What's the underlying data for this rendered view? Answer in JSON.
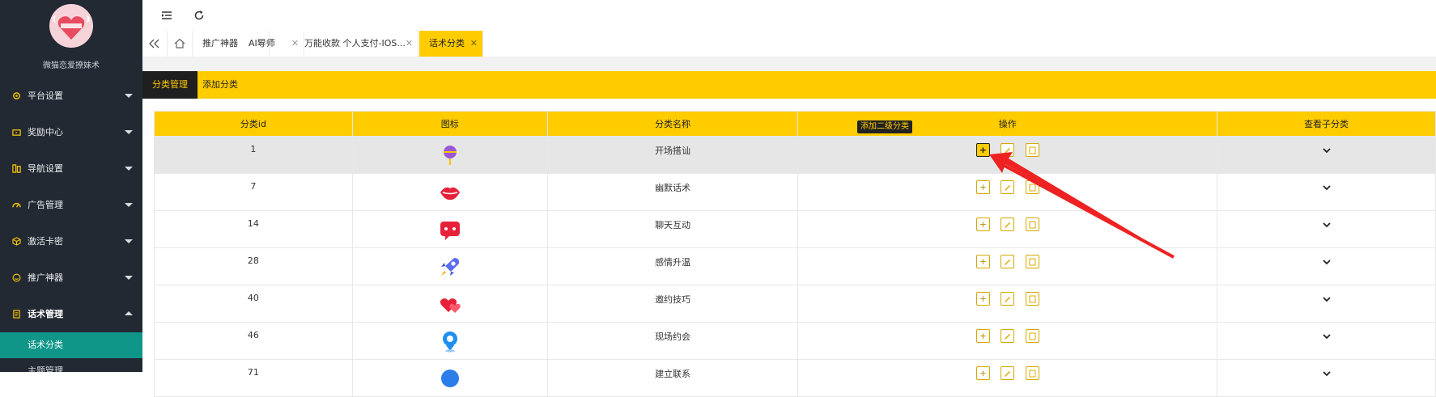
{
  "sidebar": {
    "brand": "微猫恋爱撩妹术",
    "menu": [
      {
        "label": "平台设置",
        "icon": "gear-icon"
      },
      {
        "label": "奖励中心",
        "icon": "gift-icon"
      },
      {
        "label": "导航设置",
        "icon": "nav-icon"
      },
      {
        "label": "广告管理",
        "icon": "gauge-icon"
      },
      {
        "label": "激活卡密",
        "icon": "cube-icon"
      },
      {
        "label": "推广神器",
        "icon": "smile-icon"
      },
      {
        "label": "话术管理",
        "icon": "doc-icon"
      }
    ],
    "submenu": [
      {
        "label": "话术分类"
      },
      {
        "label": "主题管理"
      }
    ]
  },
  "tabs": [
    {
      "label": "推广神器"
    },
    {
      "label": "AI导师"
    },
    {
      "label": "万能收款 个人支付-IOS..."
    },
    {
      "label": "话术分类"
    }
  ],
  "subtabs": [
    {
      "label": "分类管理"
    },
    {
      "label": "添加分类"
    }
  ],
  "table": {
    "headers": [
      "分类id",
      "图标",
      "分类名称",
      "操作",
      "查看子分类"
    ],
    "rows": [
      {
        "id": "1",
        "name": "开场搭讪",
        "icon": "lollipop-icon"
      },
      {
        "id": "7",
        "name": "幽默话术",
        "icon": "lips-icon"
      },
      {
        "id": "14",
        "name": "聊天互动",
        "icon": "chat-bubble-icon"
      },
      {
        "id": "28",
        "name": "感情升温",
        "icon": "rocket-icon"
      },
      {
        "id": "40",
        "name": "邀约技巧",
        "icon": "hearts-icon"
      },
      {
        "id": "46",
        "name": "现场约会",
        "icon": "location-icon"
      },
      {
        "id": "71",
        "name": "建立联系",
        "icon": "ball-icon"
      }
    ]
  },
  "tooltip": "添加二级分类",
  "colors": {
    "accent": "#ffcc00",
    "sidebar": "#222933",
    "active_green": "#0f9688",
    "annotation": "#ee2222"
  }
}
